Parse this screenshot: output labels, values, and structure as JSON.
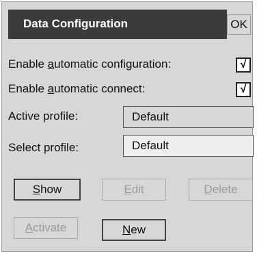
{
  "dialog": {
    "title": "Data Configuration",
    "ok_label": "OK"
  },
  "options": {
    "auto_config": {
      "label_pre": "Enable ",
      "label_mnemonic": "a",
      "label_post": "utomatic configuration:",
      "checked": true,
      "check_glyph": "√"
    },
    "auto_connect": {
      "label_pre": "Enable ",
      "label_mnemonic": "a",
      "label_post": "utomatic connect:",
      "checked": true,
      "check_glyph": "√"
    }
  },
  "profiles": {
    "active_label": "Active profile:",
    "active_value": "Default",
    "select_label": "Select profile:",
    "select_value": "Default"
  },
  "buttons": {
    "show": {
      "mnemonic": "S",
      "rest": "how",
      "enabled": true
    },
    "edit": {
      "mnemonic": "E",
      "rest": "dit",
      "enabled": false
    },
    "delete": {
      "mnemonic": "D",
      "rest": "elete",
      "enabled": false
    },
    "activate": {
      "mnemonic": "A",
      "rest": "ctivate",
      "enabled": false
    },
    "new": {
      "mnemonic": "N",
      "rest": "ew",
      "enabled": true
    }
  },
  "colors": {
    "background": "#d7d7d7",
    "titlebar": "#3b3b3b",
    "disabled_text": "#9a9a9a"
  }
}
